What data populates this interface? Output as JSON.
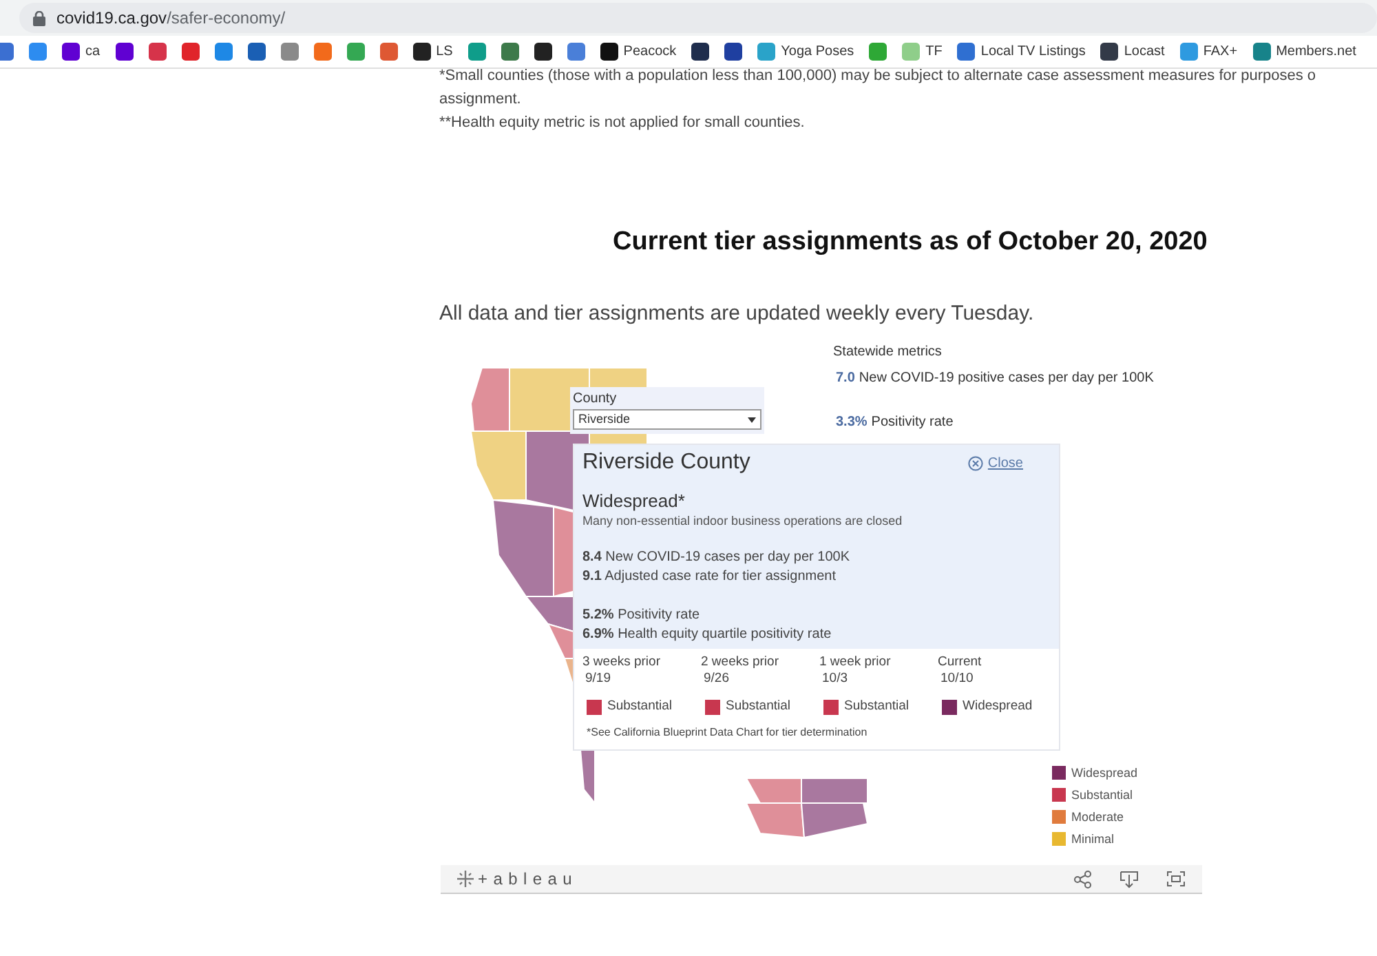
{
  "browser": {
    "url_host": "covid19.ca.gov",
    "url_path": "/safer-economy/",
    "bookmarks": [
      {
        "color": "#3b6fd1"
      },
      {
        "color": "#2d8cf0"
      },
      {
        "label": "ca",
        "color": "#6001d2"
      },
      {
        "color": "#6001d2"
      },
      {
        "color": "#d6334a"
      },
      {
        "color": "#e0242a"
      },
      {
        "color": "#1e88e5"
      },
      {
        "color": "#1a5fb4"
      },
      {
        "color": "#8a8a8a"
      },
      {
        "color": "#f26a1b"
      },
      {
        "color": "#34a853"
      },
      {
        "color": "#de5833"
      },
      {
        "label": "LS",
        "color": "#222222"
      },
      {
        "color": "#0f9d8a"
      },
      {
        "color": "#3d7a4a"
      },
      {
        "color": "#222222"
      },
      {
        "color": "#4a7fd8"
      },
      {
        "label": "Peacock",
        "color": "#111111"
      },
      {
        "color": "#1f2d4d"
      },
      {
        "color": "#1f3fa0"
      },
      {
        "label": "Yoga Poses",
        "color": "#2aa3c9"
      },
      {
        "color": "#2ea836"
      },
      {
        "label": "TF",
        "color": "#8fce8a"
      },
      {
        "label": "Local TV Listings",
        "color": "#2f6fd1"
      },
      {
        "label": "Locast",
        "color": "#333a48"
      },
      {
        "label": "FAX+",
        "color": "#2e9ae0"
      },
      {
        "label": "Members.net",
        "color": "#17838a"
      }
    ]
  },
  "page": {
    "footnotes": [
      "*Small counties (those with a population less than 100,000) may be subject to alternate case assessment measures for purposes o",
      "assignment.",
      "**Health equity metric is not applied for small counties."
    ],
    "heading": "Current tier assignments as of October 20, 2020",
    "subtitle": "All data and tier assignments are updated weekly every Tuesday."
  },
  "viz": {
    "statewide": {
      "title": "Statewide metrics",
      "metrics": [
        {
          "value": "7.0",
          "label": "New COVID-19 positive cases per day per 100K"
        },
        {
          "value": "3.3%",
          "label": "Positivity rate"
        }
      ]
    },
    "county_filter": {
      "label": "County",
      "value": "Riverside"
    },
    "tooltip": {
      "title": "Riverside County",
      "close": "Close",
      "tier": "Widespread*",
      "tier_description": "Many non-essential indoor business operations are closed",
      "metric_groups": [
        {
          "lines": [
            "**8.4** New COVID-19 cases per day per 100K",
            "**9.1** Adjusted case rate for tier assignment"
          ]
        },
        {
          "lines": [
            "**5.2%** Positivity rate",
            "**6.9%** Health equity quartile positivity rate"
          ]
        }
      ],
      "history": [
        {
          "period": "3 weeks prior",
          "date": "9/19",
          "tier": "Substantial",
          "color": "#c8374f"
        },
        {
          "period": "2 weeks prior",
          "date": "9/26",
          "tier": "Substantial",
          "color": "#c8374f"
        },
        {
          "period": "1 week prior",
          "date": "10/3",
          "tier": "Substantial",
          "color": "#c8374f"
        },
        {
          "period": "Current",
          "date": "10/10",
          "tier": "Widespread",
          "color": "#7a2a5f"
        }
      ],
      "note": "*See California Blueprint Data Chart for tier determination"
    },
    "legend": [
      {
        "label": "Widespread",
        "color": "#7a2a5f"
      },
      {
        "label": "Substantial",
        "color": "#c8374f"
      },
      {
        "label": "Moderate",
        "color": "#e07b3d"
      },
      {
        "label": "Minimal",
        "color": "#e8b830"
      }
    ],
    "toolbar": {
      "brand": "+ableau"
    }
  }
}
